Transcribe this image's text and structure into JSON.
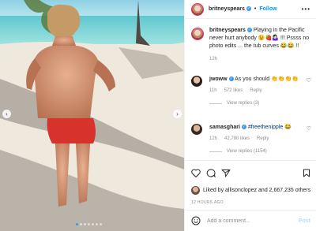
{
  "post": {
    "author": "britneyspears",
    "follow_label": "Follow",
    "more_label": "•••",
    "caption": "Playing in the Pacific never hurt anybody 😉🍓🤷🏻‍♀️ !!! Pssss no photo edits ... the tub curves 😂😂 !!",
    "caption_age": "12h",
    "likes_text": "Liked by allisonclopez and 2,667,235 others",
    "timestamp": "12 HOURS AGO"
  },
  "comments": [
    {
      "user": "jwoww",
      "text": "As you should 👏👏👏👏",
      "age": "11h",
      "likes": "572 likes",
      "reply_label": "Reply",
      "view_replies": "View replies (3)"
    },
    {
      "user": "samasghari",
      "hashtag": "#freethenipple",
      "text_suffix": "😂",
      "age": "12h",
      "likes": "42,780 likes",
      "reply_label": "Reply",
      "view_replies": "View replies (1154)"
    }
  ],
  "add_comment": {
    "placeholder": "Add a comment...",
    "post_label": "Post"
  },
  "icons": {
    "verified": "verified-badge-icon",
    "like": "heart-icon",
    "comment": "comment-bubble-icon",
    "share": "paper-plane-icon",
    "save": "bookmark-icon",
    "emoji": "smiley-icon"
  },
  "carousel": {
    "slide_count": 7,
    "active_slide": 1
  },
  "colors": {
    "link_blue": "#0095f6",
    "verified_blue": "#3897f0",
    "meta_gray": "#8e8e8e",
    "post_disabled": "#b2dffc"
  }
}
